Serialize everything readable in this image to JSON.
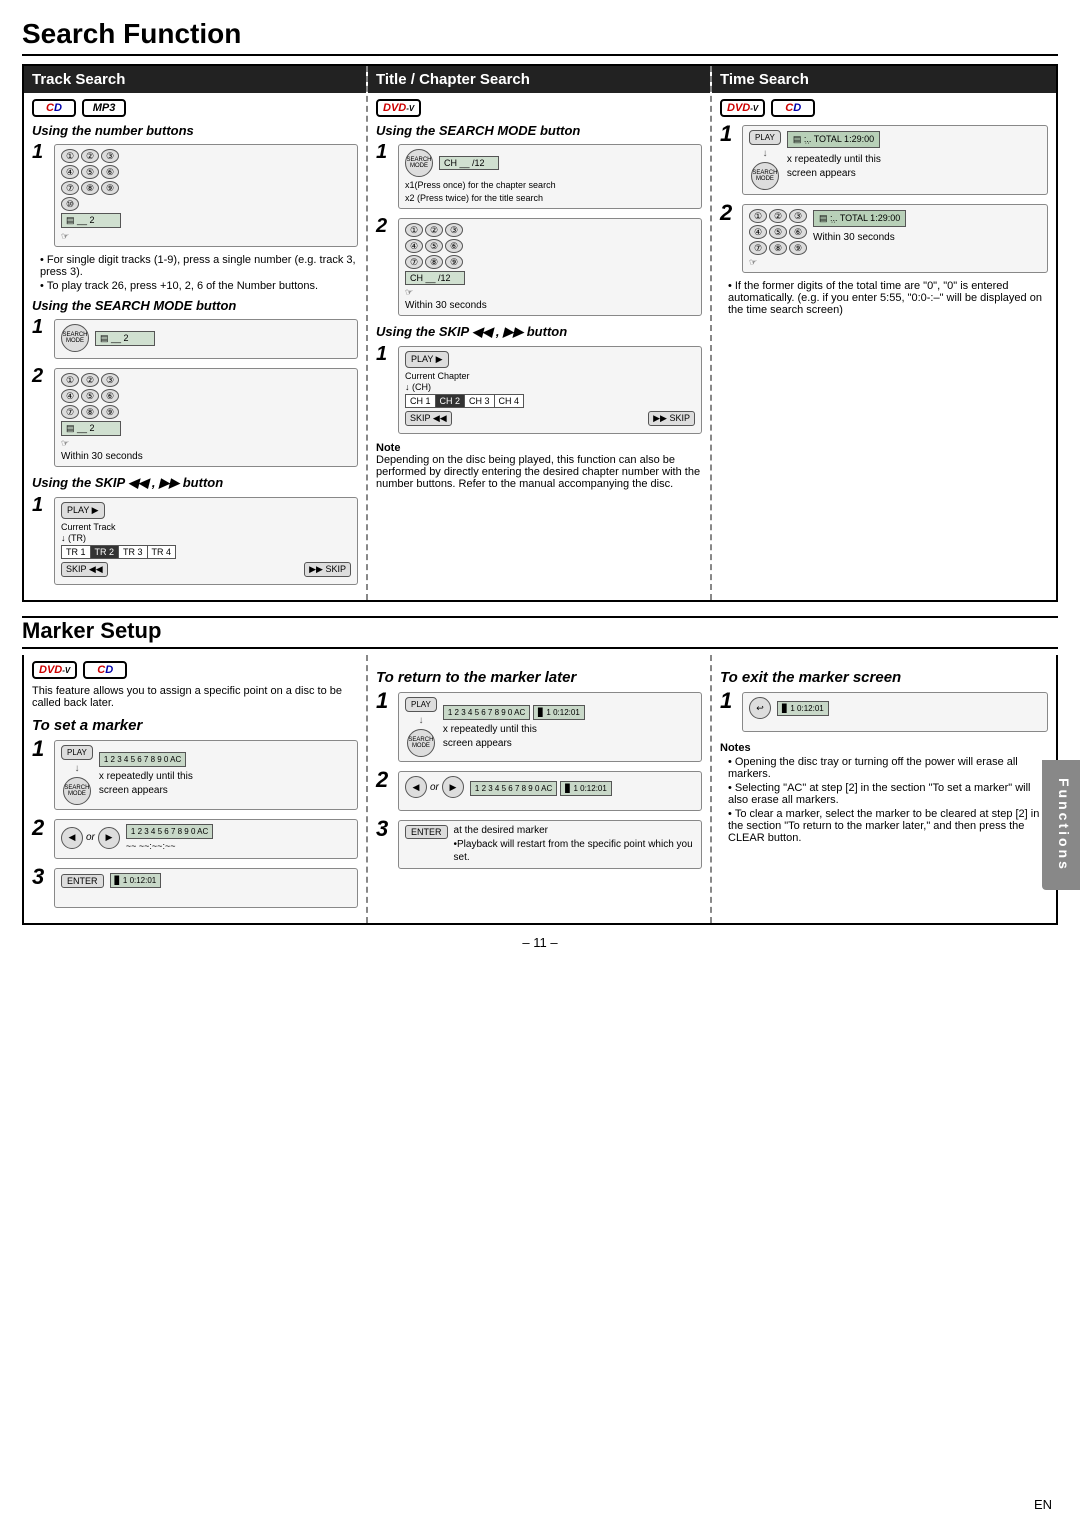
{
  "page": {
    "title": "Search Function",
    "page_number": "– 11 –",
    "en_label": "EN"
  },
  "search_section": {
    "columns": [
      {
        "id": "track",
        "header": "Track Search",
        "disc_icons": [
          "CD",
          "MP3"
        ],
        "sub_sections": [
          {
            "title": "Using the number buttons",
            "steps": [
              {
                "num": "1",
                "desc": "Press number buttons (1-9)"
              }
            ],
            "notes": [
              "For single digit tracks (1-9), press a single number (e.g. track 3, press 3).",
              "To play track 26, press +10, 2, 6 of the Number buttons."
            ]
          },
          {
            "title": "Using the SEARCH MODE button",
            "steps": [
              {
                "num": "1",
                "desc": "Press SEARCH MODE"
              },
              {
                "num": "2",
                "desc": "Enter number, within 30 seconds"
              }
            ],
            "note": "Within 30 seconds"
          },
          {
            "title": "Using the SKIP ◀◀ , ▶▶ button",
            "steps": [
              {
                "num": "1",
                "desc": "SKIP button diagram"
              }
            ],
            "tr_labels": [
              "TR 1",
              "TR 2",
              "TR 3",
              "TR 4"
            ],
            "tr_active": 1,
            "skip_left": "SKIP ◀◀",
            "skip_right": "▶▶ SKIP",
            "current_label": "Current Track",
            "arrow_label": "↓ (TR)"
          }
        ]
      },
      {
        "id": "title_chapter",
        "header": "Title / Chapter Search",
        "disc_icons": [
          "DVD-V"
        ],
        "sub_sections": [
          {
            "title": "Using the SEARCH MODE button",
            "steps": [
              {
                "num": "1",
                "desc": "x1(Press once) for the chapter search\nx2 (Press twice) for the title search"
              },
              {
                "num": "2",
                "desc": "Within 30 seconds"
              }
            ]
          },
          {
            "title": "Using the SKIP ◀◀ , ▶▶ button",
            "steps": [
              {
                "num": "1",
                "desc": "SKIP button diagram"
              }
            ],
            "ch_labels": [
              "CH 1",
              "CH 2",
              "CH 3",
              "CH 4"
            ],
            "ch_active": 1,
            "skip_left": "SKIP ◀◀",
            "skip_right": "▶▶ SKIP",
            "current_label": "Current Chapter",
            "arrow_label": "↓ (CH)"
          }
        ],
        "note_head": "Note",
        "note_text": "Depending on the disc being played, this function can also be performed by directly entering the desired chapter number with the number buttons. Refer to the manual accompanying the disc."
      },
      {
        "id": "time",
        "header": "Time Search",
        "disc_icons": [
          "DVD-V",
          "CD"
        ],
        "steps": [
          {
            "num": "1",
            "desc": "x repeatedly until this screen appears",
            "screen": "TOTAL 1:29:00"
          },
          {
            "num": "2",
            "desc": "Within 30 seconds",
            "screen": "TOTAL 1:29:00"
          }
        ],
        "note_text": "If the former digits of the total time are \"0\", \"0\" is entered automatically. (e.g. if you enter 5:55, \"0:0-:–\" will be displayed on the time search screen)"
      }
    ]
  },
  "marker_section": {
    "title": "Marker Setup",
    "columns": [
      {
        "id": "set_marker",
        "disc_icons": [
          "DVD-V",
          "CD"
        ],
        "intro": "This feature allows you to assign a specific point on a disc to be called back later.",
        "sub_title": "To set a marker",
        "steps": [
          {
            "num": "1",
            "desc": "x repeatedly until this screen appears",
            "screen": "1 2 3 4 5 6 7 8 9 0 AC"
          },
          {
            "num": "2",
            "desc": "or buttons",
            "screen": "1 2 3 4 5 6 7 8 9 0 AC"
          },
          {
            "num": "3",
            "desc": "ENTER",
            "screen": "1 0:12:01"
          }
        ]
      },
      {
        "id": "return_marker",
        "sub_title": "To return to the marker later",
        "steps": [
          {
            "num": "1",
            "desc": "x repeatedly until this screen appears",
            "screen": "1 2 3 4 5 6 7 8 9 0 AC / 1 0:12:01"
          },
          {
            "num": "2",
            "desc": "or buttons",
            "screen": "1 2 3 4 5 6 7 8 9 0 AC / 1 0:12:01"
          },
          {
            "num": "3",
            "desc": "at the desired marker\n•Playback will restart from the specific point which you set.",
            "screen": ""
          }
        ]
      },
      {
        "id": "exit_marker",
        "sub_title": "To exit the marker screen",
        "steps": [
          {
            "num": "1",
            "desc": "RETURN",
            "screen": "1 0:12:01"
          }
        ],
        "notes_head": "Notes",
        "notes": [
          "Opening the disc tray or turning off the power will erase all markers.",
          "Selecting \"AC\" at step [2] in the section \"To set a marker\" will also erase all markers.",
          "To clear a marker, select the marker to be cleared at step [2] in the section \"To return to the marker later,\" and then press the CLEAR button."
        ]
      }
    ]
  },
  "side_tab": {
    "label": "Functions"
  }
}
